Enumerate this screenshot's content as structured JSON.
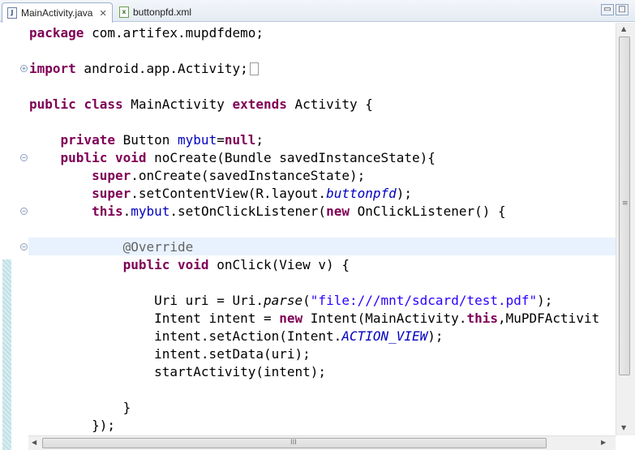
{
  "tabs": [
    {
      "label": "MainActivity.java",
      "icon": "java-file-icon",
      "active": true,
      "close": "✕"
    },
    {
      "label": "buttonpfd.xml",
      "icon": "xml-file-icon",
      "active": false
    }
  ],
  "window_buttons": {
    "minimize": "▭",
    "maximize": "□"
  },
  "code_lines": [
    [
      [
        "kw",
        "package"
      ],
      [
        "t",
        " com.artifex.mupdfdemo;"
      ]
    ],
    [],
    [
      [
        "kw",
        "import"
      ],
      [
        "t",
        " android.app.Activity;"
      ],
      [
        "collapsed",
        ""
      ]
    ],
    [],
    [
      [
        "kw",
        "public"
      ],
      [
        "t",
        " "
      ],
      [
        "kw",
        "class"
      ],
      [
        "t",
        " MainActivity "
      ],
      [
        "kw",
        "extends"
      ],
      [
        "t",
        " Activity {"
      ]
    ],
    [],
    [
      [
        "t",
        "    "
      ],
      [
        "kw",
        "private"
      ],
      [
        "t",
        " Button "
      ],
      [
        "field",
        "mybut"
      ],
      [
        "t",
        "="
      ],
      [
        "kw",
        "null"
      ],
      [
        "t",
        ";"
      ]
    ],
    [
      [
        "t",
        "    "
      ],
      [
        "kw",
        "public"
      ],
      [
        "t",
        " "
      ],
      [
        "kw",
        "void"
      ],
      [
        "t",
        " noCreate(Bundle savedInstanceState){"
      ]
    ],
    [
      [
        "t",
        "        "
      ],
      [
        "kw",
        "super"
      ],
      [
        "t",
        ".onCreate(savedInstanceState);"
      ]
    ],
    [
      [
        "t",
        "        "
      ],
      [
        "kw",
        "super"
      ],
      [
        "t",
        ".setContentView(R.layout."
      ],
      [
        "fconst",
        "buttonpfd"
      ],
      [
        "t",
        ");"
      ]
    ],
    [
      [
        "t",
        "        "
      ],
      [
        "kw",
        "this"
      ],
      [
        "t",
        "."
      ],
      [
        "field",
        "mybut"
      ],
      [
        "t",
        ".setOnClickListener("
      ],
      [
        "kw",
        "new"
      ],
      [
        "t",
        " OnClickListener() {"
      ]
    ],
    [],
    [
      [
        "t",
        "            "
      ],
      [
        "ann",
        "@Override"
      ]
    ],
    [
      [
        "t",
        "            "
      ],
      [
        "kw",
        "public"
      ],
      [
        "t",
        " "
      ],
      [
        "kw",
        "void"
      ],
      [
        "t",
        " onClick(View v) {"
      ]
    ],
    [],
    [
      [
        "t",
        "                Uri uri = Uri."
      ],
      [
        "ital",
        "parse"
      ],
      [
        "t",
        "("
      ],
      [
        "str",
        "\"file:///mnt/sdcard/test.pdf\""
      ],
      [
        "t",
        ");"
      ]
    ],
    [
      [
        "t",
        "                Intent intent = "
      ],
      [
        "kw",
        "new"
      ],
      [
        "t",
        " Intent(MainActivity."
      ],
      [
        "kw",
        "this"
      ],
      [
        "t",
        ",MuPDFActivit"
      ]
    ],
    [
      [
        "t",
        "                intent.setAction(Intent."
      ],
      [
        "fconst",
        "ACTION_VIEW"
      ],
      [
        "t",
        ");"
      ]
    ],
    [
      [
        "t",
        "                intent.setData(uri);"
      ]
    ],
    [
      [
        "t",
        "                startActivity(intent);"
      ]
    ],
    [],
    [
      [
        "t",
        "            }"
      ]
    ],
    [
      [
        "t",
        "        });"
      ]
    ]
  ],
  "fold_markers": [
    {
      "line": 2,
      "symbol": "+"
    },
    {
      "line": 7,
      "symbol": "−"
    },
    {
      "line": 10,
      "symbol": "−"
    },
    {
      "line": 12,
      "symbol": "−"
    }
  ],
  "highlighted_line": 12,
  "scrollbars": {
    "vertical": {
      "up": "▲",
      "down": "▼",
      "grip": "≡"
    },
    "horizontal": {
      "left": "◀",
      "right": "▶",
      "grip": "III"
    }
  }
}
